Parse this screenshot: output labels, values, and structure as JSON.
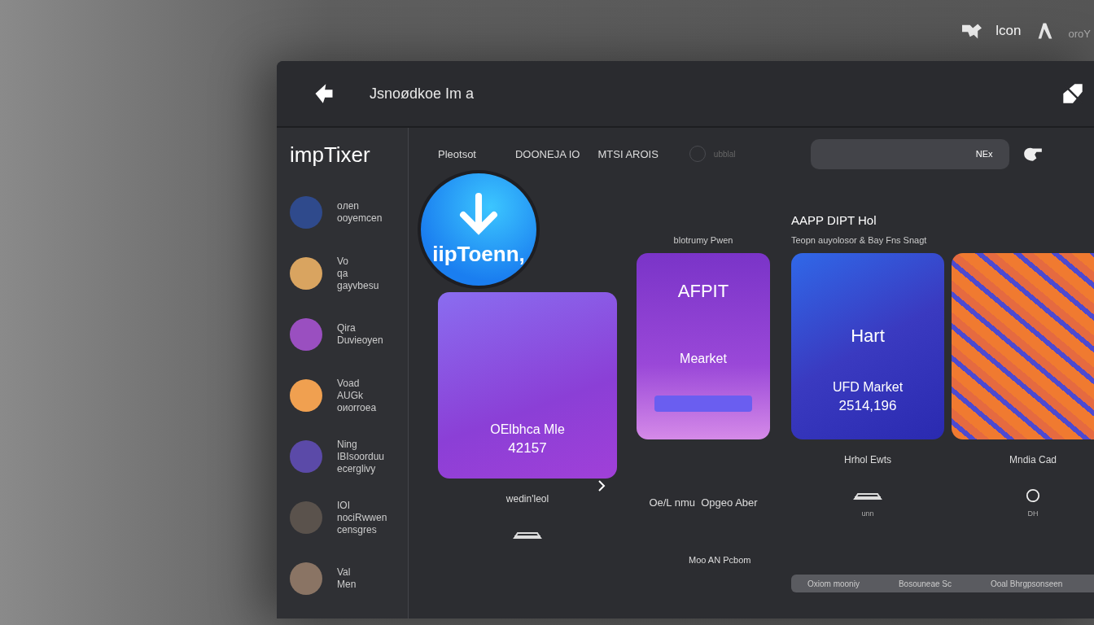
{
  "top_bar": {
    "label": "lcon",
    "trailing": "oroY"
  },
  "window": {
    "title": "Jsnoødkoe Im a"
  },
  "sidebar": {
    "logo": "impTixer",
    "items": [
      {
        "lines": [
          "oлen",
          "ooyemcen"
        ],
        "color": "#2f4a8c"
      },
      {
        "lines": [
          "Vo",
          "qa",
          "gayvbesu"
        ],
        "color": "#d9a460"
      },
      {
        "lines": [
          "Qira",
          "Duvieoyen"
        ],
        "color": "#9a4fc0"
      },
      {
        "lines": [
          "Voad",
          "AUGk",
          "oиorroea"
        ],
        "color": "#f0a050"
      },
      {
        "lines": [
          "Ning",
          "IBIsoorduu",
          "ecerglivy"
        ],
        "color": "#5b4aa8"
      },
      {
        "lines": [
          "IOI",
          "nociRwwen",
          "censgres"
        ],
        "color": "#5a524c"
      },
      {
        "lines": [
          "Val",
          "Men"
        ],
        "color": "#8a7464"
      }
    ]
  },
  "tabs": [
    {
      "label": "Pleotsot",
      "selected": false
    },
    {
      "label": "DOONEJA IO",
      "selected": false
    },
    {
      "label": "MTSI AROIS",
      "selected": false
    }
  ],
  "toggle": {
    "label": "ubblal",
    "on": false
  },
  "search": {
    "value": "NEx"
  },
  "cards": [
    {
      "kind": "badge",
      "badge": "iipToenn,",
      "lines": [
        "OElbhca Mle",
        "42157"
      ],
      "caption": "wedin'leol"
    },
    {
      "kind": "button",
      "above": "blotrumy Pwen",
      "lines": [
        "AFPIT",
        "Mearket"
      ],
      "footer": "Oe/L nmu  Opgeo Aber"
    },
    {
      "kind": "heading",
      "heading": "AAPP DIPT Hol",
      "subheading": "Teopn auyolosor & Bay Fns Snagt",
      "lines": [
        "Hart",
        "UFD Market",
        "2514,196"
      ],
      "caption": "Hrhol Ewts",
      "small": "unn"
    },
    {
      "kind": "art",
      "caption": "Mndia Cad",
      "small": "DH"
    }
  ],
  "footer": {
    "label": "Moo AN Pcbom",
    "items": [
      "Oxiom mooniy",
      "Bosouneae Sc",
      "Ooal Bhrgpsonseen"
    ]
  }
}
